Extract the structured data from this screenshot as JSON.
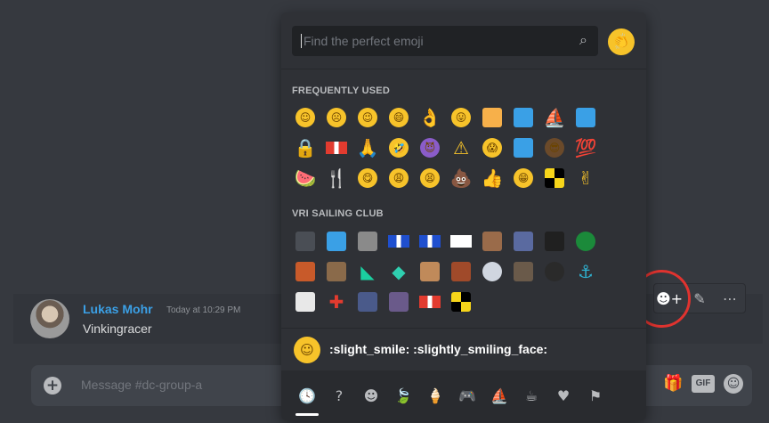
{
  "message": {
    "author": "Lukas Mohr",
    "timestamp": "Today at 10:29 PM",
    "content": "Vinkingracer"
  },
  "message_actions": [
    {
      "name": "add-reaction-icon",
      "glyph": "☻+"
    },
    {
      "name": "edit-pencil-icon",
      "glyph": "✎"
    },
    {
      "name": "more-options-icon",
      "glyph": "⋯"
    }
  ],
  "input": {
    "placeholder": "Message #dc-group-a",
    "plus_glyph": "+",
    "gift_glyph": "🎁",
    "gif_label": "GIF",
    "emoji_button_glyph": "☺"
  },
  "picker": {
    "search_placeholder": "Find the perfect emoji",
    "search_icon": "⌕",
    "clap_glyph": "👏",
    "frequent_title": "FREQUENTLY USED",
    "server_title": "VRI SAILING CLUB",
    "preview_text": ":slight_smile: :slightly_smiling_face:",
    "preview_glyph": "☺",
    "categories": [
      {
        "name": "recent-category-icon",
        "glyph": "🕓",
        "active": true
      },
      {
        "name": "custom-category-icon",
        "glyph": "?",
        "active": false
      },
      {
        "name": "people-category-icon",
        "glyph": "☻",
        "active": false
      },
      {
        "name": "nature-category-icon",
        "glyph": "🍃",
        "active": false
      },
      {
        "name": "food-category-icon",
        "glyph": "🍦",
        "active": false
      },
      {
        "name": "activity-category-icon",
        "glyph": "🎮",
        "active": false
      },
      {
        "name": "travel-category-icon",
        "glyph": "⛵",
        "active": false
      },
      {
        "name": "objects-category-icon",
        "glyph": "☕",
        "active": false
      },
      {
        "name": "symbols-category-icon",
        "glyph": "♥",
        "active": false
      },
      {
        "name": "flags-category-icon",
        "glyph": "⚑",
        "active": false
      }
    ],
    "frequently_used": [
      {
        "name": "slight-smile-emoji-icon",
        "kind": "round",
        "bg": "#f7c32a",
        "glyph": "☺"
      },
      {
        "name": "frowning-emoji-icon",
        "kind": "round",
        "bg": "#f7c32a",
        "glyph": "☹"
      },
      {
        "name": "winking-emoji-icon",
        "kind": "round",
        "bg": "#f7c32a",
        "glyph": "😉"
      },
      {
        "name": "grinning-emoji-icon",
        "kind": "round",
        "bg": "#f7c32a",
        "glyph": "😄"
      },
      {
        "name": "ok-hand-emoji-icon",
        "kind": "text",
        "bg": "#f7c32a",
        "glyph": "👌"
      },
      {
        "name": "tongue-out-emoji-icon",
        "kind": "round",
        "bg": "#f7c32a",
        "glyph": "😛"
      },
      {
        "name": "orange-square-emoji-icon",
        "kind": "sq",
        "bg": "#f7b04a",
        "glyph": ""
      },
      {
        "name": "blue-square-emoji-icon",
        "kind": "sq",
        "bg": "#3aa0e6",
        "glyph": ""
      },
      {
        "name": "sailboat-emoji-icon",
        "kind": "text",
        "bg": "#e5a22b",
        "glyph": "⛵"
      },
      {
        "name": "world-map-emoji-icon",
        "kind": "sq",
        "bg": "#3aa0e6",
        "glyph": ""
      },
      {
        "name": "lock-emoji-icon",
        "kind": "text",
        "bg": "#e5a22b",
        "glyph": "🔒"
      },
      {
        "name": "red-white-flag-emoji-icon",
        "kind": "flag",
        "bg": "#e23b2f",
        "glyph": ""
      },
      {
        "name": "folded-hands-emoji-icon",
        "kind": "text",
        "bg": "#f7c32a",
        "glyph": "🙏"
      },
      {
        "name": "rofl-emoji-icon",
        "kind": "round",
        "bg": "#f7c32a",
        "glyph": "🤣"
      },
      {
        "name": "smiling-imp-emoji-icon",
        "kind": "round",
        "bg": "#8a5cc9",
        "glyph": "😈"
      },
      {
        "name": "warning-emoji-icon",
        "kind": "text",
        "bg": "#f7c32a",
        "glyph": "⚠"
      },
      {
        "name": "scream-emoji-icon",
        "kind": "round",
        "bg": "#f7c32a",
        "glyph": "😱"
      },
      {
        "name": "club-logo-emoji-icon",
        "kind": "sq",
        "bg": "#3aa0e6",
        "glyph": ""
      },
      {
        "name": "sunglasses-man-emoji-icon",
        "kind": "round",
        "bg": "#6b4a2a",
        "glyph": "😎"
      },
      {
        "name": "hundred-points-emoji-icon",
        "kind": "text",
        "bg": "#e23b2f",
        "glyph": "💯"
      },
      {
        "name": "watermelon-emoji-icon",
        "kind": "text",
        "bg": "#e23b2f",
        "glyph": "🍉"
      },
      {
        "name": "fork-knife-emoji-icon",
        "kind": "text",
        "bg": "#b9bbbe",
        "glyph": "🍴"
      },
      {
        "name": "yum-emoji-icon",
        "kind": "round",
        "bg": "#f7c32a",
        "glyph": "😋"
      },
      {
        "name": "weary-emoji-icon",
        "kind": "round",
        "bg": "#f7c32a",
        "glyph": "😩"
      },
      {
        "name": "tired-face-emoji-icon",
        "kind": "round",
        "bg": "#f7c32a",
        "glyph": "😫"
      },
      {
        "name": "poop-emoji-icon",
        "kind": "text",
        "bg": "#8a5a3a",
        "glyph": "💩"
      },
      {
        "name": "thumbs-up-emoji-icon",
        "kind": "text",
        "bg": "#f7c32a",
        "glyph": "👍"
      },
      {
        "name": "grin-emoji-icon",
        "kind": "round",
        "bg": "#f7c32a",
        "glyph": "😁"
      },
      {
        "name": "checkered-flag-emoji-icon",
        "kind": "checker",
        "bg": "#f7d51a",
        "glyph": ""
      },
      {
        "name": "victory-hand-emoji-icon",
        "kind": "text",
        "bg": "#f7c32a",
        "glyph": "✌"
      }
    ],
    "server_emojis": [
      {
        "name": "member-photo-1-emoji-icon",
        "kind": "photo",
        "bg": "#4a4e55",
        "glyph": ""
      },
      {
        "name": "club-logo-emoji-icon",
        "kind": "sq",
        "bg": "#3aa0e6",
        "glyph": ""
      },
      {
        "name": "member-photo-2-emoji-icon",
        "kind": "photo",
        "bg": "#8a8a8a",
        "glyph": ""
      },
      {
        "name": "signal-flag-red-white-emoji-icon",
        "kind": "flag",
        "bg": "#1f4fcf",
        "glyph": ""
      },
      {
        "name": "signal-flag-blue-white-emoji-icon",
        "kind": "flag",
        "bg": "#1f4fcf",
        "glyph": ""
      },
      {
        "name": "signal-flag-red-ball-emoji-icon",
        "kind": "flag",
        "bg": "#ffffff",
        "glyph": ""
      },
      {
        "name": "member-photo-3-emoji-icon",
        "kind": "photo",
        "bg": "#9a6b4a",
        "glyph": ""
      },
      {
        "name": "member-photo-4-emoji-icon",
        "kind": "photo",
        "bg": "#5a6aa0",
        "glyph": ""
      },
      {
        "name": "new-zealand-flag-emoji-icon",
        "kind": "photo",
        "bg": "#202020",
        "glyph": ""
      },
      {
        "name": "green-circle-logo-emoji-icon",
        "kind": "round",
        "bg": "#1b8a3a",
        "glyph": ""
      },
      {
        "name": "member-photo-5-emoji-icon",
        "kind": "photo",
        "bg": "#c85a2a",
        "glyph": ""
      },
      {
        "name": "member-photo-6-emoji-icon",
        "kind": "photo",
        "bg": "#8a6a4a",
        "glyph": ""
      },
      {
        "name": "green-sail-emoji-icon",
        "kind": "text",
        "bg": "#1bcfa0",
        "glyph": "◣"
      },
      {
        "name": "diamond-logo-emoji-icon",
        "kind": "text",
        "bg": "#2fcfb0",
        "glyph": "◆"
      },
      {
        "name": "member-photo-7-emoji-icon",
        "kind": "photo",
        "bg": "#c08a5a",
        "glyph": ""
      },
      {
        "name": "member-photo-8-emoji-icon",
        "kind": "photo",
        "bg": "#a04a2a",
        "glyph": ""
      },
      {
        "name": "olympic-badge-emoji-icon",
        "kind": "round",
        "bg": "#d0d6e0",
        "glyph": ""
      },
      {
        "name": "member-photo-9-emoji-icon",
        "kind": "photo",
        "bg": "#6a5a4a",
        "glyph": ""
      },
      {
        "name": "bzh-logo-emoji-icon",
        "kind": "round",
        "bg": "#2a2a2a",
        "glyph": ""
      },
      {
        "name": "trophy-figure-emoji-icon",
        "kind": "text",
        "bg": "#2fb0cf",
        "glyph": "⚓"
      },
      {
        "name": "striped-flag-emoji-icon",
        "kind": "photo",
        "bg": "#e8e8e8",
        "glyph": ""
      },
      {
        "name": "red-cross-flag-emoji-icon",
        "kind": "text",
        "bg": "#e23b2f",
        "glyph": "✚"
      },
      {
        "name": "member-photo-10-emoji-icon",
        "kind": "photo",
        "bg": "#4a5a8a",
        "glyph": ""
      },
      {
        "name": "member-photo-11-emoji-icon",
        "kind": "photo",
        "bg": "#6a5a8a",
        "glyph": ""
      },
      {
        "name": "signal-flag-red-stripe-emoji-icon",
        "kind": "flag",
        "bg": "#e23b2f",
        "glyph": ""
      },
      {
        "name": "checkered-flag-emoji-icon",
        "kind": "checker",
        "bg": "#f7d51a",
        "glyph": ""
      }
    ]
  }
}
